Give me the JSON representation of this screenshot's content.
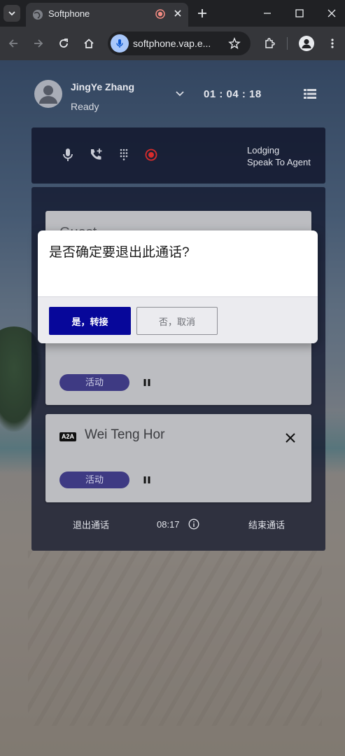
{
  "browser": {
    "tab_title": "Softphone",
    "url": "softphone.vap.e..."
  },
  "agent": {
    "name": "JingYe Zhang",
    "status": "Ready",
    "call_timer": "01 : 04 : 18"
  },
  "controls": {
    "queue_name": "Lodging",
    "queue_sub": "Speak To Agent"
  },
  "calls": {
    "card1": {
      "title": "Guest",
      "status": "活动"
    },
    "card2": {
      "badge": "A2A",
      "name": "Wei Teng Hor",
      "status": "活动"
    },
    "footer": {
      "exit_label": "退出通话",
      "duration": "08:17",
      "end_label": "结束通话"
    }
  },
  "modal": {
    "message": "是否确定要退出此通话?",
    "confirm_label": "是，转接",
    "cancel_label": "否，取消"
  },
  "icons": {
    "tab_search": "chevron-down-icon",
    "favicon": "globe-icon",
    "recording": "recording-icon",
    "mic": "microphone-icon",
    "add_call": "add-call-icon",
    "dialpad": "dialpad-icon",
    "record": "record-icon",
    "menu": "list-menu-icon",
    "info": "info-icon"
  },
  "colors": {
    "confirm_button": "#07079a",
    "status_pill": "#3e3a83",
    "record_red": "#d92c2c",
    "panel_bg": "#0e1228"
  }
}
